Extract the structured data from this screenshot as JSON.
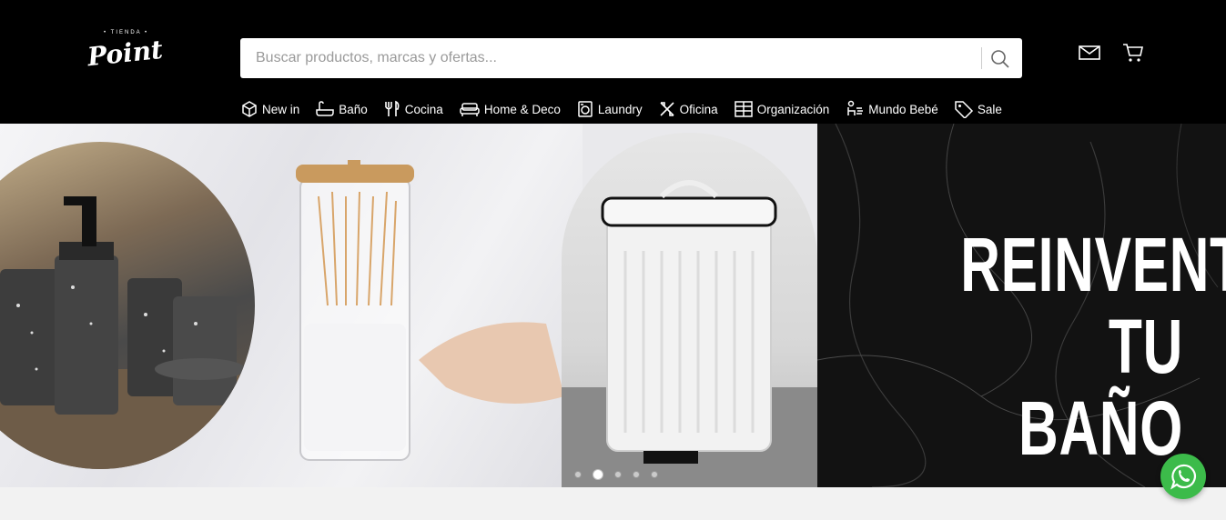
{
  "header": {
    "logo_tag": "• TIENDA •",
    "logo_word": "Point",
    "search_placeholder": "Buscar productos, marcas y ofertas..."
  },
  "nav": [
    {
      "label": "New in",
      "icon": "box-icon"
    },
    {
      "label": "Baño",
      "icon": "bathtub-icon"
    },
    {
      "label": "Cocina",
      "icon": "utensils-icon"
    },
    {
      "label": "Home & Deco",
      "icon": "sofa-icon"
    },
    {
      "label": "Laundry",
      "icon": "washing-machine-icon"
    },
    {
      "label": "Oficina",
      "icon": "tools-icon"
    },
    {
      "label": "Organización",
      "icon": "shelf-icon"
    },
    {
      "label": "Mundo Bebé",
      "icon": "baby-icon"
    },
    {
      "label": "Sale",
      "icon": "tag-icon"
    }
  ],
  "hero": {
    "line1": "REINVENTÁ",
    "line2": "TU BAÑO",
    "slides": 5,
    "active_slide": 2
  },
  "colors": {
    "header_bg": "#000000",
    "whatsapp": "#3cbb4a"
  }
}
